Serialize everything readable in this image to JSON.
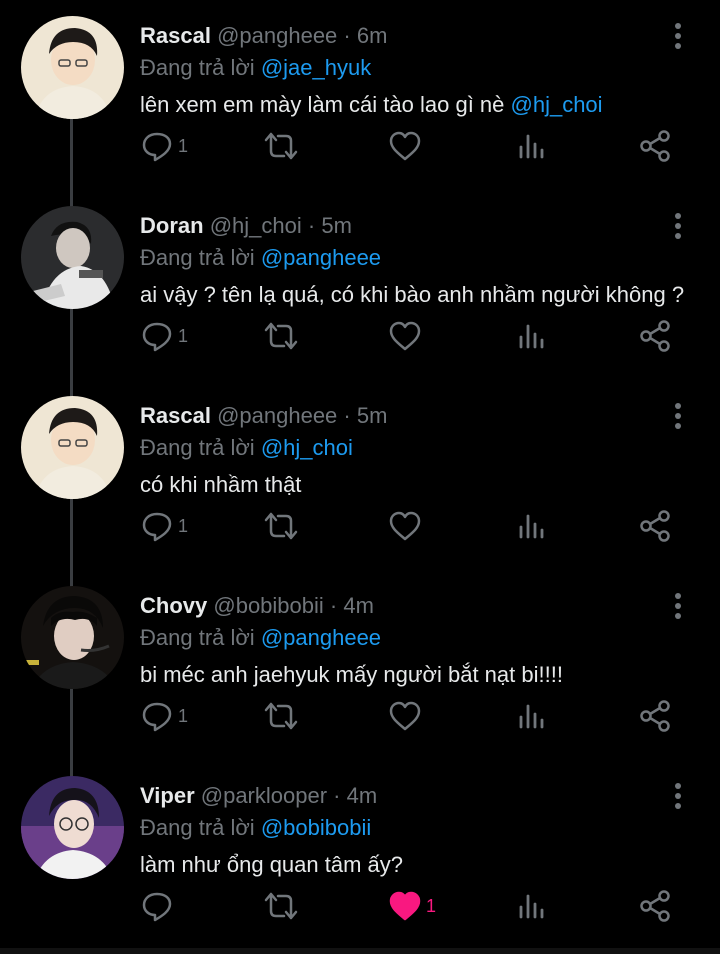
{
  "tweets": [
    {
      "name": "Rascal",
      "handle": "@pangheee",
      "time": "6m",
      "reply_prefix": "Đang trả lời",
      "reply_to": "@jae_hyuk",
      "text": "lên xem em mày làm cái tào lao gì nè ",
      "text_mention": "@hj_choi",
      "replies": "1",
      "likes": "",
      "liked": false
    },
    {
      "name": "Doran",
      "handle": "@hj_choi",
      "time": "5m",
      "reply_prefix": "Đang trả lời",
      "reply_to": "@pangheee",
      "text": "ai vậy ? tên lạ quá, có khi bào anh nhầm người không ?",
      "text_mention": "",
      "replies": "1",
      "likes": "",
      "liked": false
    },
    {
      "name": "Rascal",
      "handle": "@pangheee",
      "time": "5m",
      "reply_prefix": "Đang trả lời",
      "reply_to": "@hj_choi",
      "text": "có khi nhầm thật",
      "text_mention": "",
      "replies": "1",
      "likes": "",
      "liked": false
    },
    {
      "name": "Chovy",
      "handle": "@bobibobii",
      "time": "4m",
      "reply_prefix": "Đang trả lời",
      "reply_to": "@pangheee",
      "text": "bi méc anh jaehyuk mấy người bắt nạt bi!!!!",
      "text_mention": "",
      "replies": "1",
      "likes": "",
      "liked": false
    },
    {
      "name": "Viper",
      "handle": "@parklooper",
      "time": "4m",
      "reply_prefix": "Đang trả lời",
      "reply_to": "@bobibobii",
      "text": "làm như ổng quan tâm ấy?",
      "text_mention": "",
      "replies": "",
      "likes": "1",
      "liked": true
    }
  ],
  "separator": "·",
  "icons": {
    "reply": "reply-icon",
    "retweet": "retweet-icon",
    "like": "heart-icon",
    "views": "views-icon",
    "share": "share-icon",
    "more": "more-vertical-icon"
  },
  "colors": {
    "background": "#000000",
    "text": "#e7e9ea",
    "muted": "#71767b",
    "accent": "#1d9bf0",
    "like": "#f91880"
  }
}
